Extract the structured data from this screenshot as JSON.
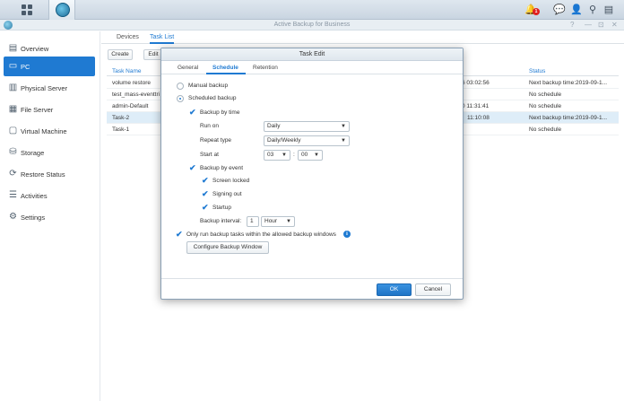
{
  "topbar": {
    "notification_count": "1",
    "icons": [
      "main-menu-icon",
      "active-backup-icon",
      "notification-icon",
      "chat-icon",
      "user-icon",
      "search-icon",
      "widgets-icon"
    ]
  },
  "window": {
    "title": "Active Backup for Business",
    "controls": [
      "?",
      "—",
      "⊡",
      "✕"
    ]
  },
  "sidebar": {
    "items": [
      {
        "label": "Overview",
        "icon": "overview-icon",
        "glyph": "▤"
      },
      {
        "label": "PC",
        "icon": "pc-icon",
        "glyph": "▭"
      },
      {
        "label": "Physical Server",
        "icon": "server-icon",
        "glyph": "▥"
      },
      {
        "label": "File Server",
        "icon": "file-server-icon",
        "glyph": "▦"
      },
      {
        "label": "Virtual Machine",
        "icon": "vm-icon",
        "glyph": "▢"
      },
      {
        "label": "Storage",
        "icon": "storage-icon",
        "glyph": "⛁"
      },
      {
        "label": "Restore Status",
        "icon": "restore-icon",
        "glyph": "⟳"
      },
      {
        "label": "Activities",
        "icon": "activities-icon",
        "glyph": "☰"
      },
      {
        "label": "Settings",
        "icon": "settings-icon",
        "glyph": "⚙"
      }
    ]
  },
  "main": {
    "tabs": [
      "Devices",
      "Task List"
    ],
    "toolbar": {
      "create": "Create",
      "edit": "Edit"
    },
    "columns": {
      "name": "Task Name",
      "status": "Status"
    },
    "rows": [
      {
        "name": "volume restore",
        "time": "6 03:02:56",
        "status": "Next backup time:2019-09-1..."
      },
      {
        "name": "test_mass-eventtri",
        "time": "",
        "status": "No schedule"
      },
      {
        "name": "admin-Default",
        "time": "0 11:31:41",
        "status": "No schedule"
      },
      {
        "name": "Task-2",
        "time": "11:10:08",
        "status": "Next backup time:2019-09-1..."
      },
      {
        "name": "Task-1",
        "time": "",
        "status": "No schedule"
      }
    ]
  },
  "modal": {
    "title": "Task Edit",
    "tabs": [
      "General",
      "Schedule",
      "Retention"
    ],
    "manual_backup": "Manual backup",
    "scheduled_backup": "Scheduled backup",
    "backup_by_time": "Backup by time",
    "run_on_label": "Run on",
    "run_on_value": "Daily",
    "repeat_type_label": "Repeat type",
    "repeat_type_value": "Daily/Weekly",
    "start_at_label": "Start at",
    "start_hour": "03",
    "start_minute": "00",
    "time_sep": ":",
    "backup_by_event": "Backup by event",
    "screen_locked": "Screen locked",
    "signing_out": "Signing out",
    "startup": "Startup",
    "backup_interval_label": "Backup interval:",
    "backup_interval_value": "1",
    "backup_interval_unit": "Hour",
    "only_run_window": "Only run backup tasks within the allowed backup windows",
    "configure_window": "Configure Backup Window",
    "ok": "OK",
    "cancel": "Cancel"
  }
}
